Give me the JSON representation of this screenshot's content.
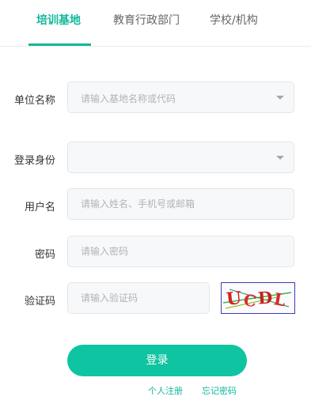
{
  "tabs": [
    {
      "label": "培训基地"
    },
    {
      "label": "教育行政部门"
    },
    {
      "label": "学校/机构"
    }
  ],
  "form": {
    "unit": {
      "label": "单位名称",
      "placeholder": "请输入基地名称或代码"
    },
    "identity": {
      "label": "登录身份",
      "value": ""
    },
    "username": {
      "label": "用户名",
      "placeholder": "请输入姓名、手机号或邮箱"
    },
    "password": {
      "label": "密码",
      "placeholder": "请输入密码"
    },
    "captcha": {
      "label": "验证码",
      "placeholder": "请输入验证码",
      "image_text": "UCDL"
    }
  },
  "actions": {
    "login": "登录",
    "register": "个人注册",
    "forgot": "忘记密码"
  },
  "colors": {
    "accent": "#10b89a",
    "button": "#0fc4a1"
  }
}
